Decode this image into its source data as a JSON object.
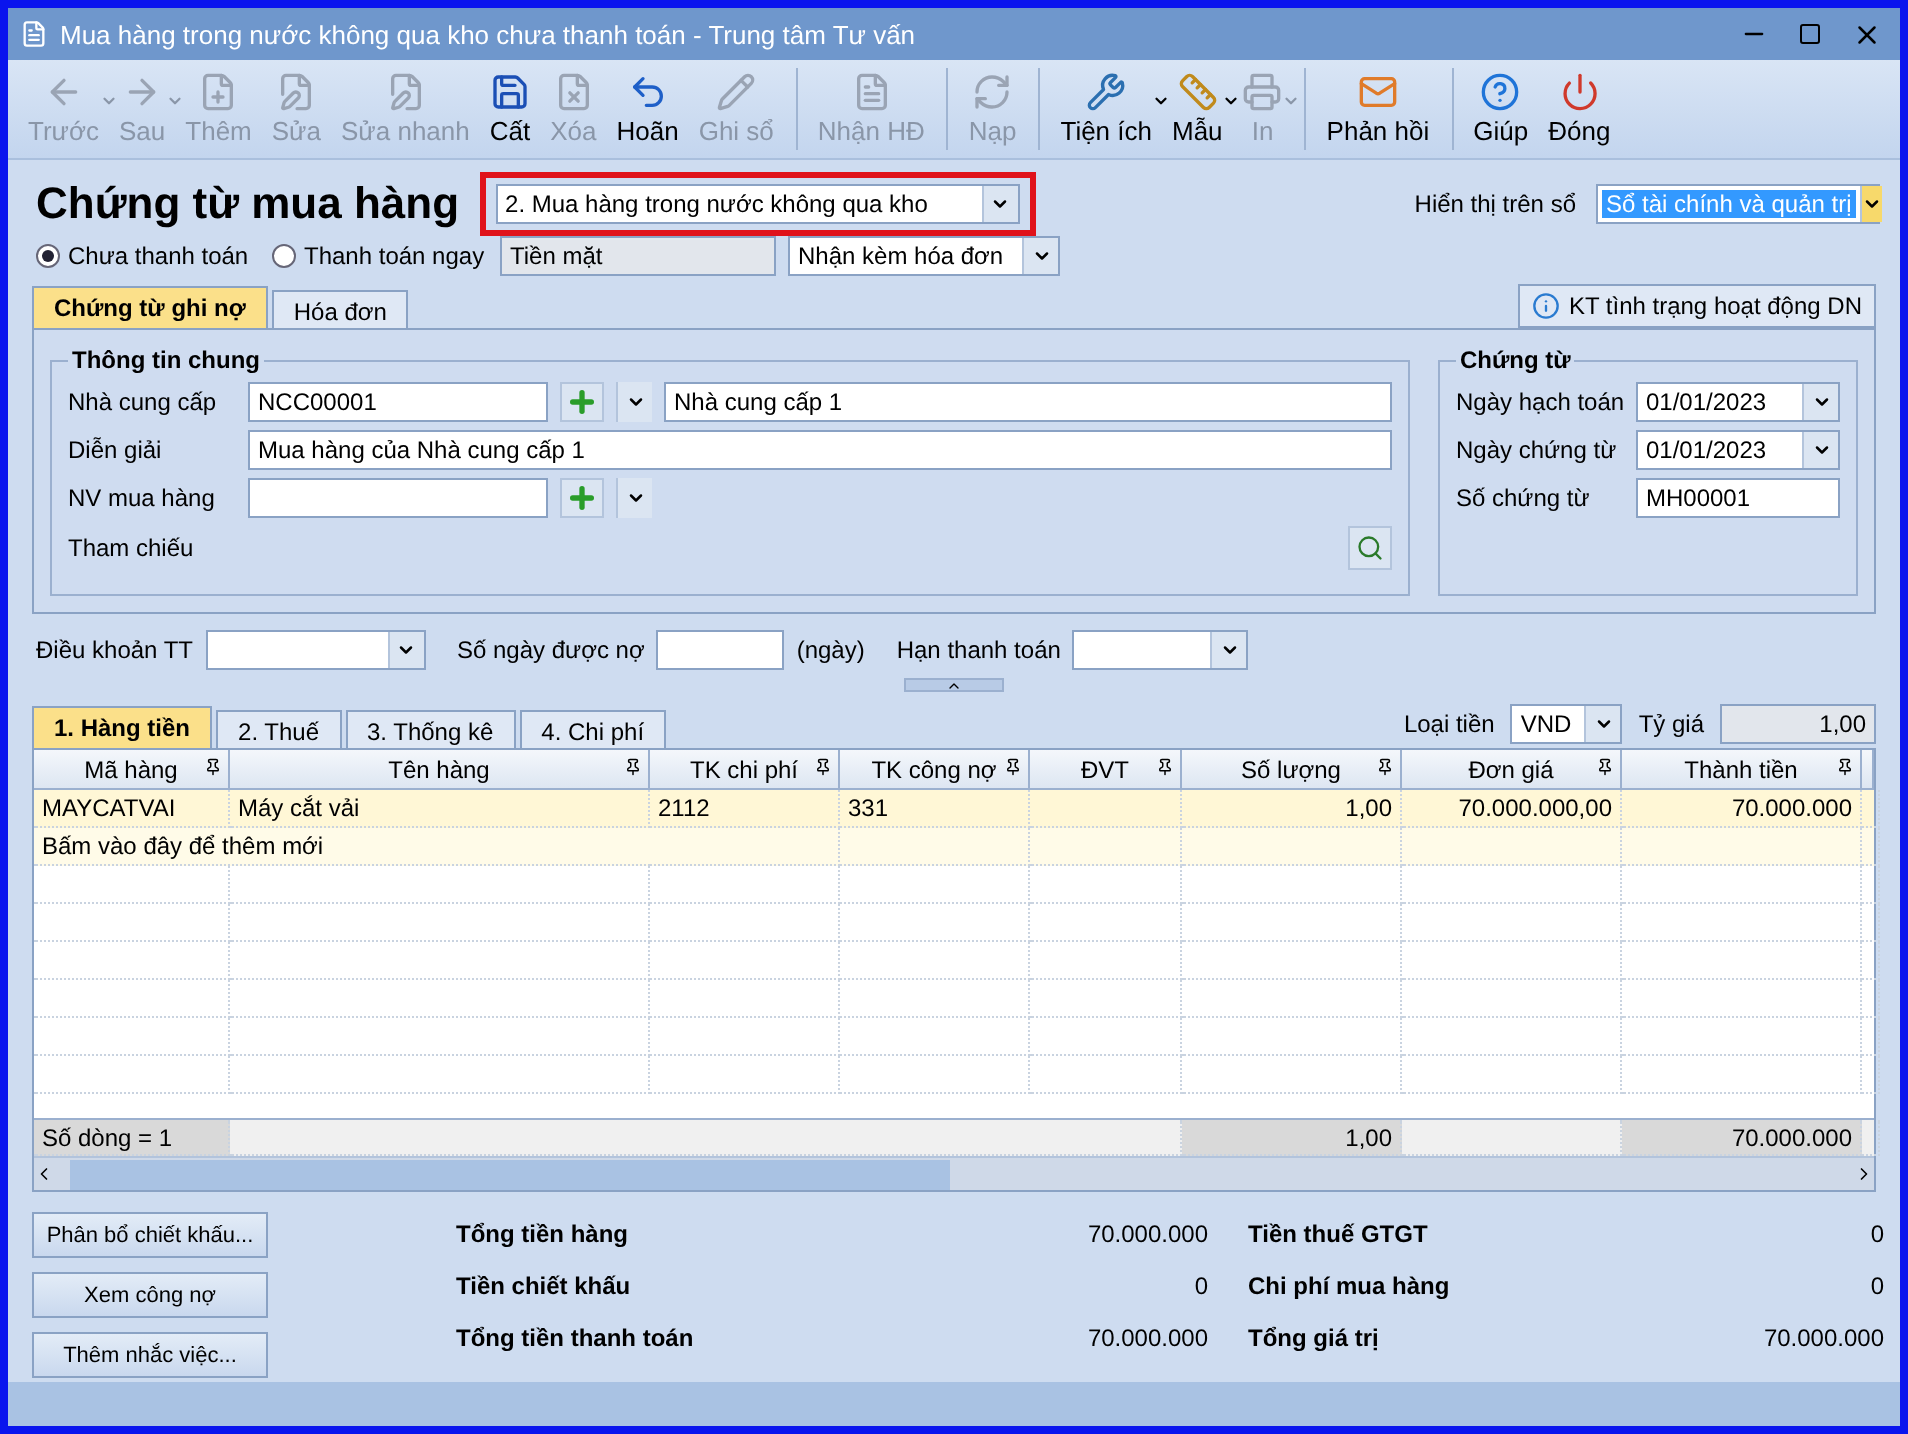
{
  "window": {
    "title": "Mua hàng trong nước không qua kho chưa thanh toán - Trung tâm Tư vấn"
  },
  "toolbar": [
    {
      "label": "Trước",
      "kind": "back",
      "disabled": true,
      "dropdown": true,
      "separator_before": false
    },
    {
      "label": "Sau",
      "kind": "forward",
      "disabled": true,
      "dropdown": true,
      "separator_before": false
    },
    {
      "label": "Thêm",
      "kind": "add",
      "disabled": true,
      "dropdown": false,
      "separator_before": false
    },
    {
      "label": "Sửa",
      "kind": "edit",
      "disabled": true,
      "dropdown": false,
      "separator_before": false
    },
    {
      "label": "Sửa nhanh",
      "kind": "quickedit",
      "disabled": true,
      "dropdown": false,
      "separator_before": false
    },
    {
      "label": "Cất",
      "kind": "save",
      "disabled": false,
      "dropdown": false,
      "separator_before": false
    },
    {
      "label": "Xóa",
      "kind": "delete",
      "disabled": true,
      "dropdown": false,
      "separator_before": false
    },
    {
      "label": "Hoãn",
      "kind": "undo",
      "disabled": false,
      "dropdown": false,
      "separator_before": false
    },
    {
      "label": "Ghi sổ",
      "kind": "post",
      "disabled": true,
      "dropdown": false,
      "separator_before": false
    },
    {
      "label": "Nhận HĐ",
      "kind": "invoice",
      "disabled": true,
      "dropdown": false,
      "separator_before": true
    },
    {
      "label": "Nạp",
      "kind": "reload",
      "disabled": true,
      "dropdown": false,
      "separator_before": true
    },
    {
      "label": "Tiện ích",
      "kind": "tools",
      "disabled": false,
      "dropdown": true,
      "separator_before": true
    },
    {
      "label": "Mẫu",
      "kind": "template",
      "disabled": false,
      "dropdown": true,
      "separator_before": false
    },
    {
      "label": "In",
      "kind": "print",
      "disabled": true,
      "dropdown": true,
      "separator_before": false
    },
    {
      "label": "Phản hồi",
      "kind": "feedback",
      "disabled": false,
      "dropdown": false,
      "separator_before": true
    },
    {
      "label": "Giúp",
      "kind": "help",
      "disabled": false,
      "dropdown": false,
      "separator_before": true
    },
    {
      "label": "Đóng",
      "kind": "close",
      "disabled": false,
      "dropdown": false,
      "separator_before": false
    }
  ],
  "header": {
    "title": "Chứng từ mua hàng",
    "voucher_type": "2. Mua hàng trong nước không qua kho",
    "display_label": "Hiển thị trên sổ",
    "display_value": "Sổ tài chính và quản trị"
  },
  "payment_options": [
    {
      "label": "Chưa thanh toán",
      "selected": true
    },
    {
      "label": "Thanh toán ngay",
      "selected": false
    }
  ],
  "payment_method": "Tiền mặt",
  "invoice_option": "Nhận kèm hóa đơn",
  "tabs": [
    {
      "label": "Chứng từ ghi nợ",
      "selected": true
    },
    {
      "label": "Hóa đơn",
      "selected": false
    }
  ],
  "status_button": "KT tình trạng hoạt động DN",
  "general": {
    "title": "Thông tin chung",
    "supplier_label": "Nhà cung cấp",
    "supplier_code": "NCC00001",
    "supplier_name": "Nhà cung cấp 1",
    "description_label": "Diễn giải",
    "description": "Mua hàng của Nhà cung cấp 1",
    "buyer_label": "NV mua hàng",
    "reference_label": "Tham chiếu"
  },
  "voucher": {
    "title": "Chứng từ",
    "posting_date_label": "Ngày hạch toán",
    "posting_date": "01/01/2023",
    "voucher_date_label": "Ngày chứng từ",
    "voucher_date": "01/01/2023",
    "number_label": "Số chứng từ",
    "number": "MH00001"
  },
  "terms": {
    "terms_label": "Điều khoản TT",
    "days_label": "Số ngày được nợ",
    "days_unit": "(ngày)",
    "due_label": "Hạn thanh toán"
  },
  "detail_tabs": [
    {
      "label": "1. Hàng tiền",
      "selected": true
    },
    {
      "label": "2. Thuế",
      "selected": false
    },
    {
      "label": "3. Thống kê",
      "selected": false
    },
    {
      "label": "4. Chi phí",
      "selected": false
    }
  ],
  "currency": {
    "label": "Loại tiền",
    "value": "VND",
    "rate_label": "Tỷ giá",
    "rate": "1,00"
  },
  "table": {
    "columns": [
      "Mã hàng",
      "Tên hàng",
      "TK chi phí",
      "TK công nợ",
      "ĐVT",
      "Số lượng",
      "Đơn giá",
      "Thành tiền"
    ],
    "rows": [
      [
        "MAYCATVAI",
        "Máy cắt vải",
        "2112",
        "331",
        "",
        "1,00",
        "70.000.000,00",
        "70.000.000"
      ]
    ],
    "add_hint": "Bấm vào đây để thêm mới",
    "footer": {
      "count": "Số dòng = 1",
      "quantity": "1,00",
      "amount": "70.000.000"
    }
  },
  "side_buttons": [
    "Phân bổ chiết khấu...",
    "Xem công nợ",
    "Thêm nhắc việc..."
  ],
  "totals": [
    {
      "label": "Tổng tiền hàng",
      "value": "70.000.000"
    },
    {
      "label": "Tiền thuế GTGT",
      "value": "0"
    },
    {
      "label": "Tiền chiết khấu",
      "value": "0"
    },
    {
      "label": "Chi phí mua hàng",
      "value": "0"
    },
    {
      "label": "Tổng tiền thanh toán",
      "value": "70.000.000"
    },
    {
      "label": "Tổng giá trị",
      "value": "70.000.000"
    }
  ]
}
